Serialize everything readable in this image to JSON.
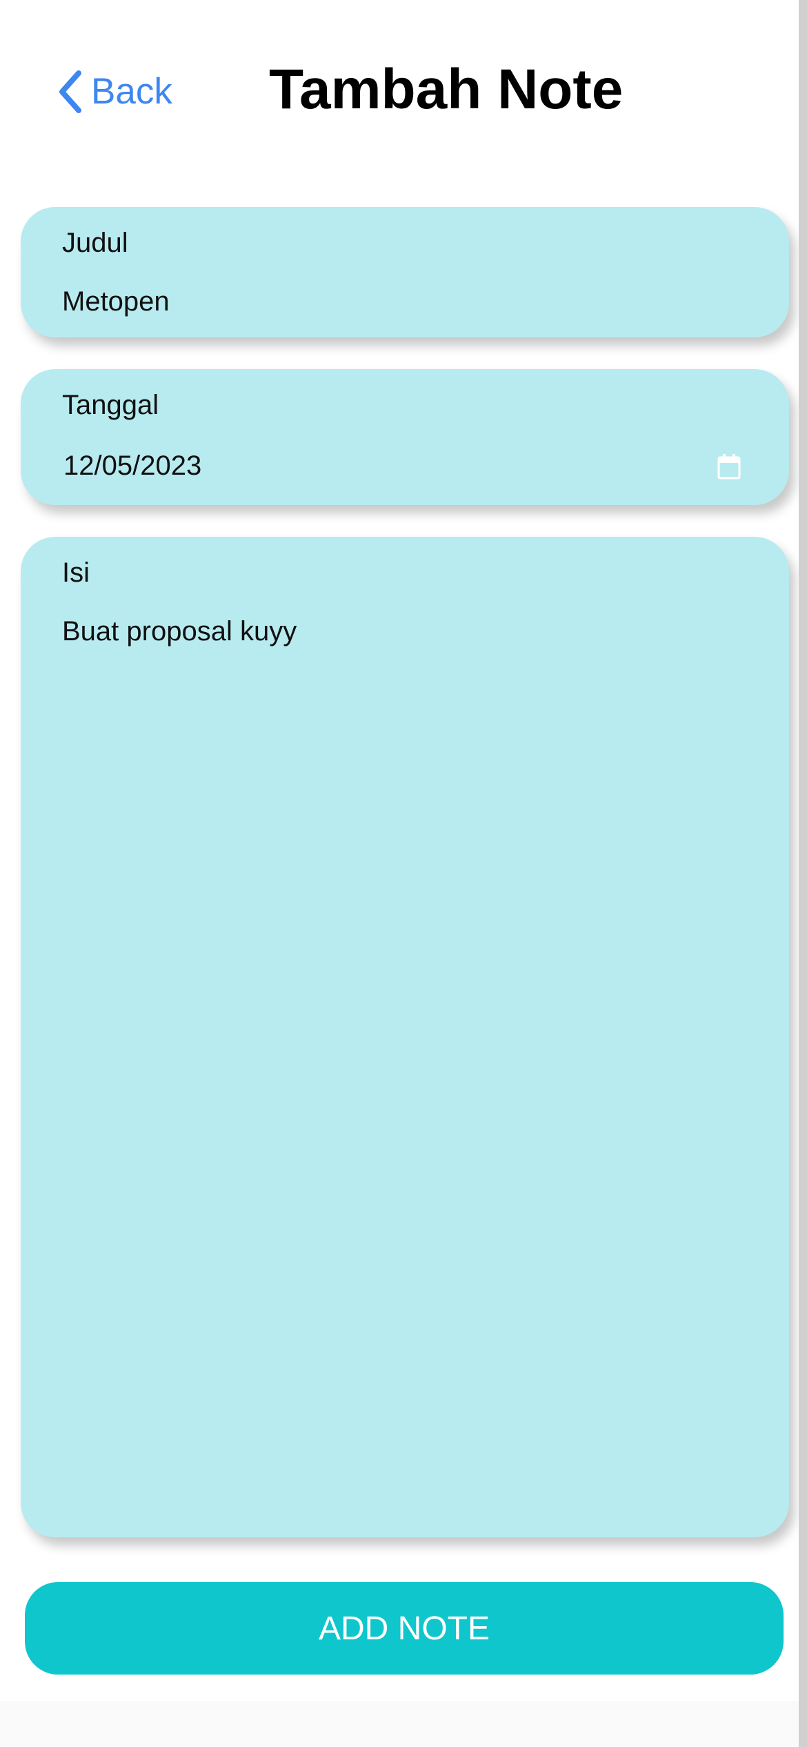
{
  "header": {
    "back_label": "Back",
    "title": "Tambah Note"
  },
  "form": {
    "judul": {
      "label": "Judul",
      "value": "Metopen"
    },
    "tanggal": {
      "label": "Tanggal",
      "value": "12/05/2023",
      "icon": "calendar-icon"
    },
    "isi": {
      "label": "Isi",
      "value": "Buat proposal kuyy"
    }
  },
  "actions": {
    "add_label": "ADD NOTE"
  },
  "colors": {
    "accent_blue": "#3e86f0",
    "card_bg": "#b8ebef",
    "button_bg": "#0fc6cc"
  }
}
